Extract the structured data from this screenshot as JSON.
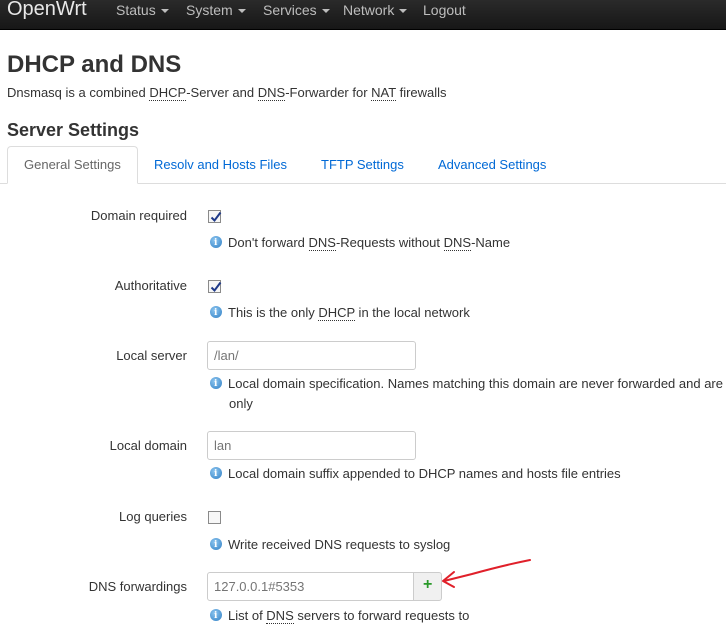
{
  "navbar": {
    "brand": "OpenWrt",
    "menus": [
      {
        "label": "Status"
      },
      {
        "label": "System"
      },
      {
        "label": "Services"
      },
      {
        "label": "Network"
      }
    ],
    "logout": "Logout"
  },
  "page": {
    "title": "DHCP and DNS",
    "desc_parts": [
      "Dnsmasq is a combined ",
      "DHCP",
      "-Server and ",
      "DNS",
      "-Forwarder for ",
      "NAT",
      " firewalls"
    ]
  },
  "section": {
    "title": "Server Settings",
    "tabs": [
      "General Settings",
      "Resolv and Hosts Files",
      "TFTP Settings",
      "Advanced Settings"
    ]
  },
  "fields": {
    "domain_required": {
      "label": "Domain required",
      "checked": true,
      "help_parts": [
        "Don't forward ",
        "DNS",
        "-Requests without ",
        "DNS",
        "-Name"
      ]
    },
    "authoritative": {
      "label": "Authoritative",
      "checked": true,
      "help_parts": [
        "This is the only ",
        "DHCP",
        " in the local network"
      ]
    },
    "local_server": {
      "label": "Local server",
      "placeholder": "/lan/",
      "help_line1": "Local domain specification. Names matching this domain are never forwarded and are",
      "help_line2": "only"
    },
    "local_domain": {
      "label": "Local domain",
      "placeholder": "lan",
      "help": "Local domain suffix appended to DHCP names and hosts file entries"
    },
    "log_queries": {
      "label": "Log queries",
      "checked": false,
      "help": "Write received DNS requests to syslog"
    },
    "dns_forwardings": {
      "label": "DNS forwardings",
      "placeholder": "127.0.0.1#5353",
      "add_symbol": "+",
      "help_parts": [
        "List of ",
        "DNS",
        " servers to forward requests to"
      ]
    }
  },
  "colors": {
    "navbar_bg": "#1f1f1f",
    "link": "#0069d6",
    "add_icon": "#2a9a2a",
    "annotation": "#e0202a"
  }
}
